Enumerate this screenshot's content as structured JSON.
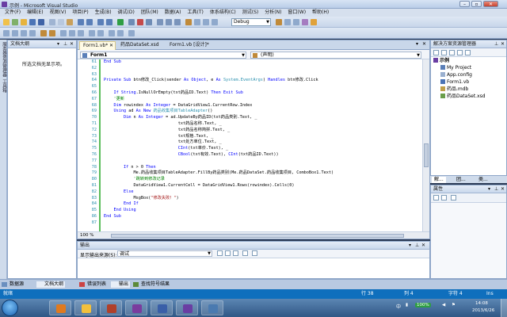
{
  "window": {
    "title": "示例 - Microsoft Visual Studio"
  },
  "menu": [
    "文件(F)",
    "编辑(E)",
    "视图(V)",
    "项目(P)",
    "生成(B)",
    "调试(D)",
    "团队(M)",
    "数据(A)",
    "工具(T)",
    "体系结构(C)",
    "测试(S)",
    "分析(N)",
    "窗口(W)",
    "帮助(H)"
  ],
  "toolbar": {
    "config": "Debug"
  },
  "left_strip": [
    "服务器资源管理器",
    "工具箱"
  ],
  "doc_outline": {
    "title": "文档大纲",
    "empty_text": "所选文档无显示项。"
  },
  "tabs": [
    {
      "label": "Form1.vb*",
      "active": true
    },
    {
      "label": "药品DataSet.xsd",
      "active": false
    },
    {
      "label": "Form1.vb [设计]*",
      "active": false
    }
  ],
  "nav": {
    "left": "Form1",
    "right": "(声明)"
  },
  "code": {
    "line_numbers": [
      "61",
      "62",
      "63",
      "64",
      "65",
      "66",
      "67",
      "68",
      "69",
      "70",
      "71",
      "72",
      "73",
      "74",
      "75",
      "76",
      "77",
      "78",
      "79",
      "80",
      "81",
      "82",
      "83",
      "84",
      "85",
      "86",
      "87"
    ],
    "lines": [
      [
        [
          "kw",
          "End Sub"
        ]
      ],
      [],
      [],
      [
        [
          "kw",
          "Private Sub "
        ],
        [
          "",
          "btn修改_Click(sender "
        ],
        [
          "kw",
          "As Object"
        ],
        [
          "",
          ", e "
        ],
        [
          "kw",
          "As "
        ],
        [
          "ty",
          "System.EventArgs"
        ],
        [
          "",
          ") "
        ],
        [
          "kw",
          "Handles "
        ],
        [
          "",
          "btn修改.Click"
        ]
      ],
      [],
      [
        [
          "kw",
          "    If String"
        ],
        [
          "",
          ".IsNullOrEmpty(txt药品ID.Text) "
        ],
        [
          "kw",
          "Then Exit Sub"
        ]
      ],
      [
        [
          "cm",
          "    '更新"
        ]
      ],
      [
        [
          "kw",
          "    Dim "
        ],
        [
          "",
          "rowindex "
        ],
        [
          "kw",
          "As Integer "
        ],
        [
          "",
          "= DataGridView1.CurrentRow.Index"
        ]
      ],
      [
        [
          "kw",
          "    Using "
        ],
        [
          "",
          "ad "
        ],
        [
          "kw",
          "As New "
        ],
        [
          "ty",
          "药品收集项目TableAdapter"
        ],
        [
          "",
          "()"
        ]
      ],
      [
        [
          "kw",
          "        Dim "
        ],
        [
          "",
          "n "
        ],
        [
          "kw",
          "As Integer "
        ],
        [
          "",
          "= ad.UpdateBy药品ID(txt药品类别.Text, _"
        ]
      ],
      [
        [
          "",
          "                              txt药品名称.Text, _"
        ]
      ],
      [
        [
          "",
          "                              txt药品名称简拼.Text, _"
        ]
      ],
      [
        [
          "",
          "                              txt规格.Text, _"
        ]
      ],
      [
        [
          "",
          "                              txt处方单位.Text, _"
        ]
      ],
      [
        [
          "",
          "                              "
        ],
        [
          "kw",
          "CInt"
        ],
        [
          "",
          "(txt单价.Text), _"
        ]
      ],
      [
        [
          "",
          "                              "
        ],
        [
          "kw",
          "CBool"
        ],
        [
          "",
          "(txt有效.Text), "
        ],
        [
          "kw",
          "CInt"
        ],
        [
          "",
          "(txt药品ID.Text))"
        ]
      ],
      [],
      [
        [
          "kw",
          "        If "
        ],
        [
          "",
          "n > 0 "
        ],
        [
          "kw",
          "Then"
        ]
      ],
      [
        [
          "",
          "            Me.药品收集项目TableAdapter.FillBy药品类别(Me.药品DataSet.药品收集项目, ComboBox1.Text)"
        ]
      ],
      [
        [
          "cm",
          "            '跳转到修改记录"
        ]
      ],
      [
        [
          "",
          "            DataGridView1.CurrentCell = DataGridView1.Rows(rowindex).Cells(0)"
        ]
      ],
      [
        [
          "kw",
          "        Else"
        ]
      ],
      [
        [
          "",
          "            MsgBox("
        ],
        [
          "st",
          "\"修改失败！\""
        ],
        [
          "",
          ")"
        ]
      ],
      [
        [
          "kw",
          "        End If"
        ]
      ],
      [
        [
          "kw",
          "    End Using"
        ]
      ],
      [
        [
          "kw",
          "End Sub"
        ]
      ],
      []
    ]
  },
  "editor_zoom": "100 %",
  "solution": {
    "title": "解决方案资源管理器",
    "items": [
      "示例",
      "My Project",
      "App.config",
      "Form1.vb",
      "药品.mdb",
      "药品DataSet.xsd"
    ],
    "tabs": [
      "解...",
      "团...",
      "类..."
    ]
  },
  "properties": {
    "title": "属性"
  },
  "output": {
    "title": "输出",
    "source_label": "显示输出来源(S):",
    "source_value": "调试"
  },
  "bottom_tabs": [
    {
      "label": "数据源",
      "color": "#6a8fbf"
    },
    {
      "label": "文档大纲",
      "color": "#8aa9cf"
    },
    {
      "label": "错误列表",
      "color": "#c44"
    },
    {
      "label": "输出",
      "color": "#4a7ab0"
    },
    {
      "label": "查找符号结果",
      "color": "#5c8a3a"
    }
  ],
  "status": {
    "left": "就绪",
    "line": "行 38",
    "col": "列 4",
    "ch": "字符 4",
    "mode": "Ins"
  },
  "taskbar": {
    "clock_time": "14:08",
    "clock_date": "2013/6/26",
    "zoom": "100%",
    "apps": [
      "#e07a1f",
      "#f2c03c",
      "#b0402a",
      "#7a3c9e",
      "#3a5fa8",
      "#6a3ea3",
      "#4a7ab0"
    ]
  }
}
